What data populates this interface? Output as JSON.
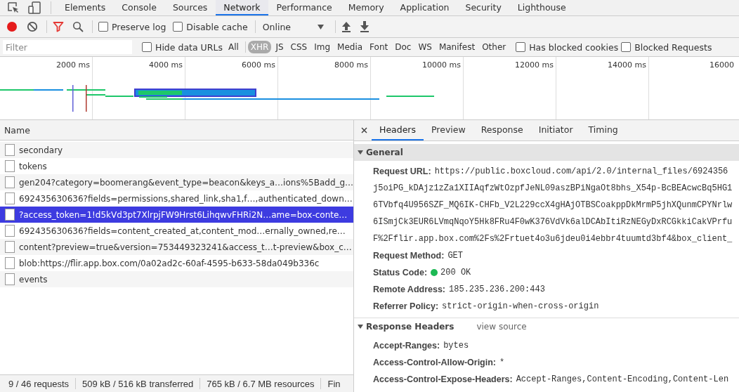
{
  "panel_tabs": [
    {
      "label": "Elements",
      "selected": false
    },
    {
      "label": "Console",
      "selected": false
    },
    {
      "label": "Sources",
      "selected": false
    },
    {
      "label": "Network",
      "selected": true
    },
    {
      "label": "Performance",
      "selected": false
    },
    {
      "label": "Memory",
      "selected": false
    },
    {
      "label": "Application",
      "selected": false
    },
    {
      "label": "Security",
      "selected": false
    },
    {
      "label": "Lighthouse",
      "selected": false
    }
  ],
  "toolbar": {
    "recording": true,
    "filter_active": true,
    "checkboxes": [
      {
        "label": "Preserve log",
        "checked": false
      },
      {
        "label": "Disable cache",
        "checked": false
      }
    ],
    "throttling": "Online"
  },
  "filter_bar": {
    "placeholder": "Filter",
    "hide_data_urls": {
      "label": "Hide data URLs",
      "checked": false
    },
    "types": [
      {
        "label": "All",
        "selected": false
      },
      {
        "label": "XHR",
        "selected": true
      },
      {
        "label": "JS",
        "selected": false
      },
      {
        "label": "CSS",
        "selected": false
      },
      {
        "label": "Img",
        "selected": false
      },
      {
        "label": "Media",
        "selected": false
      },
      {
        "label": "Font",
        "selected": false
      },
      {
        "label": "Doc",
        "selected": false
      },
      {
        "label": "WS",
        "selected": false
      },
      {
        "label": "Manifest",
        "selected": false
      },
      {
        "label": "Other",
        "selected": false
      }
    ],
    "checkboxes": [
      {
        "label": "Has blocked cookies",
        "checked": false
      },
      {
        "label": "Blocked Requests",
        "checked": false
      }
    ]
  },
  "overview": {
    "ticks": [
      "2000 ms",
      "4000 ms",
      "6000 ms",
      "8000 ms",
      "10000 ms",
      "12000 ms",
      "14000 ms",
      "16000"
    ]
  },
  "requests": {
    "column": "Name",
    "rows": [
      {
        "name": "secondary",
        "selected": false
      },
      {
        "name": "tokens",
        "selected": false
      },
      {
        "name": "gen204?category=boomerang&event_type=beacon&keys_a…ions%5Badd_g…",
        "selected": false
      },
      {
        "name": "692435630636?fields=permissions,shared_link,sha1,f…,authenticated_down…",
        "selected": false
      },
      {
        "name": "?access_token=1!d5kVd3pt7XlrpjFW9Hrst6LihqwvFHRi2N…ame=box-conte…",
        "selected": true
      },
      {
        "name": "692435630636?fields=content_created_at,content_mod…ernally_owned,re…",
        "selected": false
      },
      {
        "name": "content?preview=true&version=753449323241&access_t…t-preview&box_c…",
        "selected": false
      },
      {
        "name": "blob:https://flir.app.box.com/0a02ad2c-60af-4595-b633-58da049b336c",
        "selected": false
      },
      {
        "name": "events",
        "selected": false
      }
    ]
  },
  "details": {
    "tabs": [
      {
        "label": "Headers",
        "selected": true
      },
      {
        "label": "Preview",
        "selected": false
      },
      {
        "label": "Response",
        "selected": false
      },
      {
        "label": "Initiator",
        "selected": false
      },
      {
        "label": "Timing",
        "selected": false
      }
    ],
    "sections": [
      {
        "title": "General",
        "expanded": true,
        "fields": [
          {
            "kind": "url",
            "key": "Request URL:",
            "lines": [
              "https://public.boxcloud.com/api/2.0/internal_files/6924356",
              "j5oiPG_kDAjz1zZa1XIIAqfzWtOzpfJeNL09aszBPiNgaOt8bhs_X54p-BcBEAcwcBq5HG1",
              "6TVbfq4U956SZF_MQ6IK-CHFb_V2L229ccX4gHAjOTBSCoakppDkMrmP5jhXQunmCPYNrlw",
              "6ISmjCk3EUR6LVmqNqoY5Hk8FRu4F0wK376VdVk6alDCAbItiRzNEGyDxRCGkkiCakVPrfu",
              "F%2Fflir.app.box.com%2Fs%2Frtuet4o3u6jdeu0i4ebbr4tuumtd3bf4&box_client_"
            ]
          },
          {
            "kind": "text",
            "key": "Request Method:",
            "value": "GET"
          },
          {
            "kind": "status",
            "key": "Status Code:",
            "value": "200 OK"
          },
          {
            "kind": "text",
            "key": "Remote Address:",
            "value": "185.235.236.200:443"
          },
          {
            "kind": "text",
            "key": "Referrer Policy:",
            "value": "strict-origin-when-cross-origin"
          }
        ]
      },
      {
        "title": "Response Headers",
        "expanded": true,
        "link": "view source",
        "fields": [
          {
            "kind": "text",
            "key": "Accept-Ranges:",
            "value": "bytes"
          },
          {
            "kind": "text",
            "key": "Access-Control-Allow-Origin:",
            "value": "*"
          },
          {
            "kind": "text",
            "key": "Access-Control-Expose-Headers:",
            "value": "Accept-Ranges,Content-Encoding,Content-Len"
          }
        ]
      }
    ]
  },
  "status_bar": [
    "9 / 46 requests",
    "509 kB / 516 kB transferred",
    "765 kB / 6.7 MB resources",
    "Fin"
  ]
}
